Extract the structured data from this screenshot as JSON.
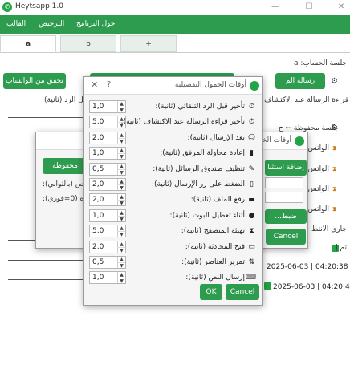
{
  "app": {
    "title": "Heytsapp 1.0",
    "menu": [
      "القالب",
      "الترخيص",
      "حول البرنامج"
    ]
  },
  "tabs": [
    "a",
    "b",
    "+"
  ],
  "main": {
    "session_label": "جلسة الحساب: a",
    "read_receipt_label": "قراءة الرسالة عند الاكتشاف",
    "reply_before_label": "قبل الرد (ثانية):",
    "saved_session_label": "جلسة محفوظة ← ح",
    "status_label": "جاري الانتظ",
    "buttons": {
      "check_whatsapp": "تحقق من الواتساب",
      "send_message": "رسالة الم",
      "add": "إضافة استثنا",
      "search": "...ضبط",
      "cancel": "Cancel"
    },
    "whatsapp_rows": [
      "الواتس",
      "الواتس",
      "الواتس",
      "الواتس"
    ],
    "log": [
      {
        "time": "2025-06-03 | 04:20:38",
        "text": "",
        "checked": false
      },
      {
        "time": "2025-06-03 | 04:20:44",
        "text": "تم إ",
        "checked": true
      }
    ]
  },
  "back_dialog": {
    "title": "أوقات الخمول",
    "saved_label": "محفوظة",
    "label1": "بص (بالثواني):",
    "label2": "ه (0=فوري):",
    "buttons": {
      "ok": "OK",
      "cancel": "Cancel"
    }
  },
  "detail_dialog": {
    "title": "أوقات الخمول التفصيلية",
    "rows": [
      {
        "label": "تأخير قبل الرد التلقائي (ثانية):",
        "value": "1,0",
        "icon": "stopwatch-icon",
        "glyph": "⏱"
      },
      {
        "label": "تأخير قراءة الرسالة عند الاكتشاف (ثانية):",
        "value": "5,0",
        "icon": "stopwatch-icon",
        "glyph": "⏱"
      },
      {
        "label": "بعد الإرسال (ثانية):",
        "value": "2,0",
        "icon": "smile-icon",
        "glyph": "☺"
      },
      {
        "label": "إعادة محاولة المرفق (ثانية):",
        "value": "1,0",
        "icon": "battery-icon",
        "glyph": "▮"
      },
      {
        "label": "تنظيف صندوق الرسائل (ثانية):",
        "value": "0,5",
        "icon": "broom-icon",
        "glyph": "✎"
      },
      {
        "label": "الضغط على زر الإرسال (ثانية):",
        "value": "2,0",
        "icon": "mouse-icon",
        "glyph": "▯"
      },
      {
        "label": "رفع الملف (ثانية):",
        "value": "2,0",
        "icon": "folder-icon",
        "glyph": "▬"
      },
      {
        "label": "أثناء تعطيل البوت (ثانية):",
        "value": "1,0",
        "icon": "stop-icon",
        "glyph": "●"
      },
      {
        "label": "تهيئة المتصفح (ثانية):",
        "value": "5,0",
        "icon": "hourglass-icon",
        "glyph": "⧗"
      },
      {
        "label": "فتح المحادثة (ثانية):",
        "value": "2,0",
        "icon": "chat-icon",
        "glyph": "▭"
      },
      {
        "label": "تمرير العناصر (ثانية):",
        "value": "0,5",
        "icon": "scroll-icon",
        "glyph": "⇅"
      },
      {
        "label": "إرسال النص (ثانية):",
        "value": "1,0",
        "icon": "keyboard-icon",
        "glyph": "⌨"
      }
    ],
    "buttons": {
      "ok": "OK",
      "cancel": "Cancel"
    }
  }
}
